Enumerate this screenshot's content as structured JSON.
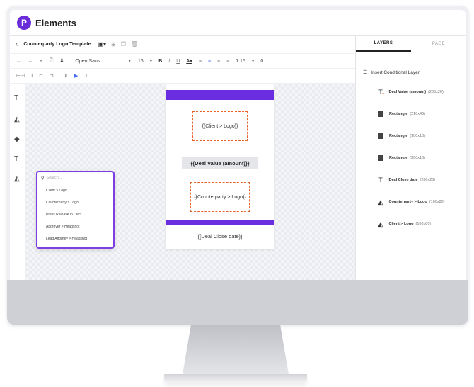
{
  "app": {
    "logo_letter": "P",
    "title": "Elements"
  },
  "editor": {
    "template_name": "Counterparty Logo Template",
    "font_family": "Open Sans",
    "font_size": "16",
    "line_height": "1.15",
    "zero_value": "0"
  },
  "canvas": {
    "client_logo": "{{Client > Logo}}",
    "deal_value": "{{Deal Value (amount)}}",
    "counterparty_logo": "{{Counterparty > Logo}}",
    "deal_close": "{{Deal Close date}}"
  },
  "dropdown": {
    "search_placeholder": "Search...",
    "items": [
      "Client > Logo",
      "Counterparty > Logo",
      "Press Release in DMS",
      "Approver > Headshot",
      "Lead Attorney > Headshot"
    ]
  },
  "layers_panel": {
    "tabs": [
      "LAYERS",
      "PAGE"
    ],
    "insert_conditional": "Insert Conditional Layer",
    "items": [
      {
        "name": "Deal Value (amount)",
        "size": "(260x20)",
        "icon": "text-icon"
      },
      {
        "name": "Rectangle",
        "size": "(210x40)",
        "icon": "rectangle-icon"
      },
      {
        "name": "Rectangle",
        "size": "(300x10)",
        "icon": "rectangle-icon"
      },
      {
        "name": "Rectangle",
        "size": "(300x10)",
        "icon": "rectangle-icon"
      },
      {
        "name": "Deal Close date",
        "size": "(260x20)",
        "icon": "text-icon"
      },
      {
        "name": "Counterparty > Logo",
        "size": "(160x80)",
        "icon": "image-icon"
      },
      {
        "name": "Client > Logo",
        "size": "(160x80)",
        "icon": "image-icon"
      }
    ]
  },
  "colors": {
    "accent": "#6b2de0",
    "placeholder_border": "#e8642a"
  }
}
